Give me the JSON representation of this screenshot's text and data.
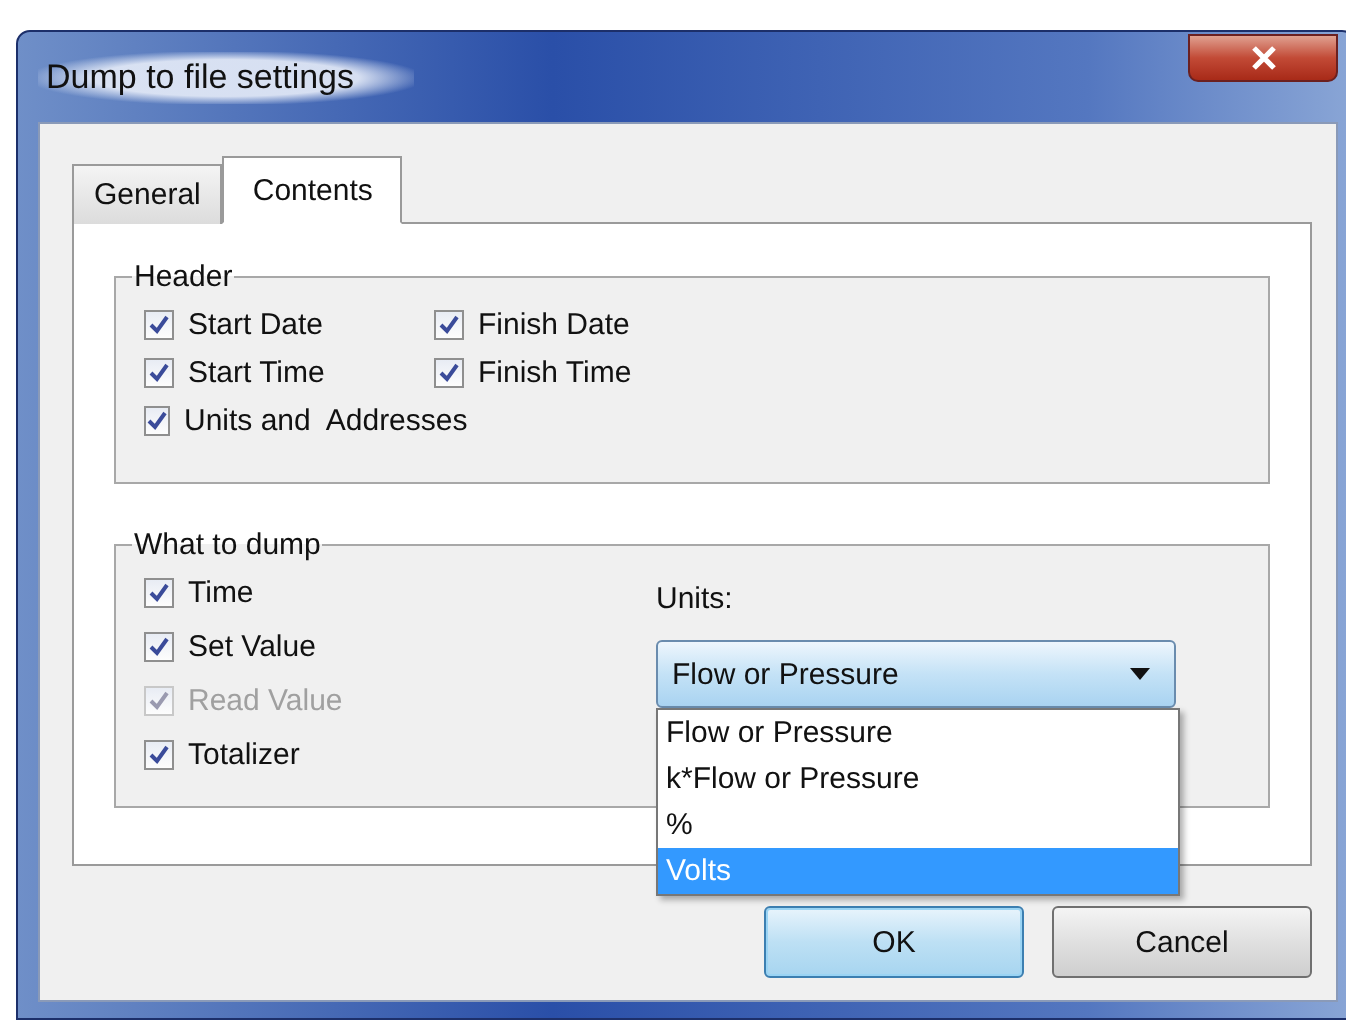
{
  "window": {
    "title": "Dump to file settings"
  },
  "tabs": [
    {
      "label": "General",
      "selected": false
    },
    {
      "label": "Contents",
      "selected": true
    }
  ],
  "header_group": {
    "title": "Header",
    "options": [
      {
        "label": "Start Date",
        "checked": true,
        "disabled": false
      },
      {
        "label": "Finish Date",
        "checked": true,
        "disabled": false
      },
      {
        "label": "Start Time",
        "checked": true,
        "disabled": false
      },
      {
        "label": "Finish Time",
        "checked": true,
        "disabled": false
      },
      {
        "label": "Units and  Addresses",
        "checked": true,
        "disabled": false
      }
    ]
  },
  "dump_group": {
    "title": "What to dump",
    "options": [
      {
        "label": "Time",
        "checked": true,
        "disabled": false
      },
      {
        "label": "Set Value",
        "checked": true,
        "disabled": false
      },
      {
        "label": "Read Value",
        "checked": true,
        "disabled": true
      },
      {
        "label": "Totalizer",
        "checked": true,
        "disabled": false
      }
    ],
    "units": {
      "label": "Units:",
      "value": "Flow or Pressure",
      "expanded": true,
      "options": [
        {
          "label": "Flow or Pressure",
          "highlighted": false
        },
        {
          "label": "k*Flow or Pressure",
          "highlighted": false
        },
        {
          "label": "%",
          "highlighted": false
        },
        {
          "label": "Volts",
          "highlighted": true
        }
      ]
    }
  },
  "buttons": [
    {
      "label": "OK",
      "focused": true
    },
    {
      "label": "Cancel",
      "focused": false
    }
  ]
}
